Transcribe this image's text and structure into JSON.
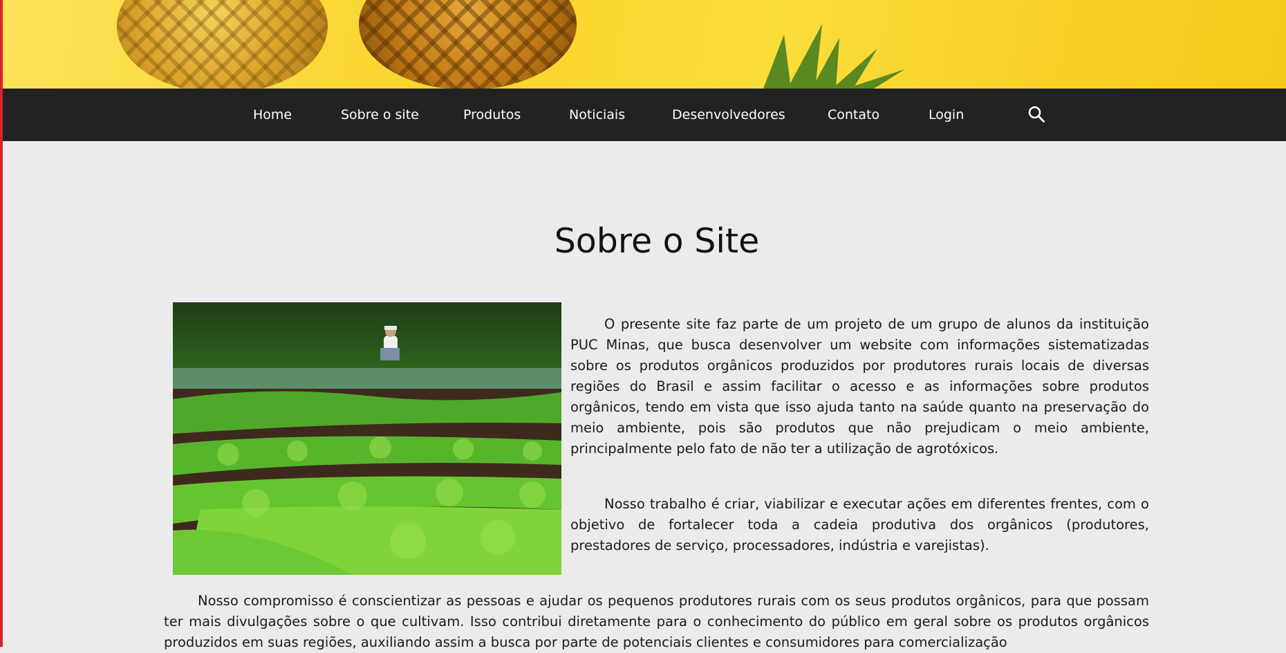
{
  "nav": {
    "items": [
      {
        "label": "Home"
      },
      {
        "label": "Sobre o site"
      },
      {
        "label": "Produtos"
      },
      {
        "label": "Noticiais"
      },
      {
        "label": "Desenvolvedores"
      },
      {
        "label": "Contato"
      },
      {
        "label": "Login"
      }
    ],
    "search_icon": "search-icon"
  },
  "page": {
    "title": "Sobre o Site",
    "paragraphs": [
      "O presente site faz parte de um projeto de um grupo de alunos da instituição PUC Minas, que busca desenvolver um website com informações sistematizadas sobre os produtos orgânicos produzidos por produtores rurais locais de diversas regiões do Brasil e assim facilitar o acesso e as informações sobre produtos orgânicos, tendo em vista que isso ajuda tanto na saúde quanto na preservação do meio ambiente, pois são produtos que não prejudicam o meio ambiente, principalmente pelo fato de não ter a utilização de agrotóxicos.",
      "Nosso trabalho é criar, viabilizar e executar ações em diferentes frentes, com o objetivo de fortalecer toda a cadeia produtiva dos orgânicos (produtores, prestadores de serviço, processadores, indústria e varejistas).",
      "Nosso compromisso é conscientizar as pessoas e ajudar os pequenos produtores rurais com os seus produtos orgânicos, para que possam ter mais divulgações sobre o que cultivam. Isso contribui diretamente para o conhecimento do público em geral sobre os produtos orgânicos produzidos em suas regiões, auxiliando assim a busca por parte de potenciais clientes e consumidores para comercialização"
    ]
  },
  "colors": {
    "navbar_bg": "#222222",
    "page_bg": "#ebebeb",
    "banner_yellow": "#f9d42b",
    "left_edge": "#d8232a"
  }
}
